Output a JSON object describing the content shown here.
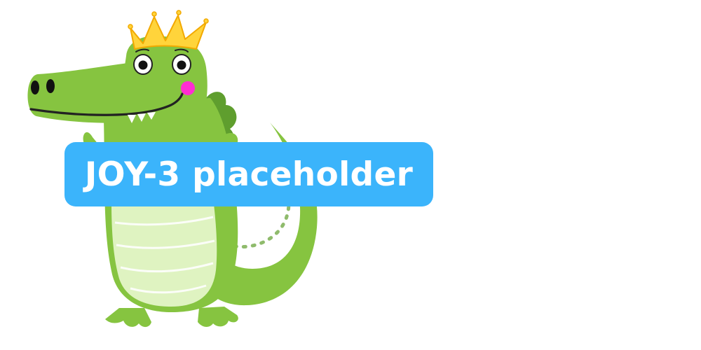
{
  "label": {
    "text": "JOY-3 placeholder",
    "background_color": "#3bb4fb",
    "text_color": "#ffffff"
  },
  "mascot": {
    "icon": "crowned-crocodile-illustration",
    "body_color": "#86c440",
    "dark_green": "#5f9e2e",
    "belly_color": "#dff3c1",
    "crown_color": "#ffd43b",
    "cheek_color": "#ff2ed2"
  }
}
